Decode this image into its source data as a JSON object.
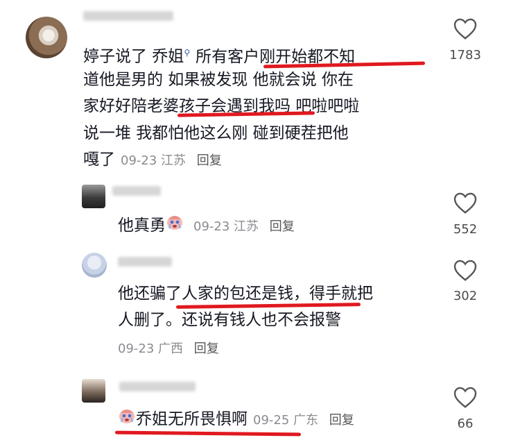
{
  "comments": [
    {
      "lines": [
        "婷子说了  乔姐",
        "所有客户刚开始都不知",
        "道他是男的 如果被发现 他就会说  你在",
        "家好好陪老婆孩子会遇到我吗  吧啦吧啦",
        "说一堆  我都怕他这么刚  碰到硬茬把他",
        "嘎了"
      ],
      "date": "09-23",
      "location": "江苏",
      "reply": "回复",
      "likes": "1783"
    },
    {
      "text": "他真勇",
      "date": "09-23",
      "location": "江苏",
      "reply": "回复",
      "likes": "552"
    },
    {
      "lines": [
        "他还骗了人家的包还是钱，得手就把",
        "人删了。还说有钱人也不会报警"
      ],
      "date": "09-23",
      "location": "广西",
      "reply": "回复",
      "likes": "302"
    },
    {
      "text": "乔姐无所畏惧啊",
      "date": "09-25",
      "location": "广东",
      "reply": "回复",
      "likes": "66"
    }
  ],
  "colors": {
    "underline": "#e0191f",
    "meta": "#8a8b91",
    "text": "#161823"
  },
  "icons": {
    "like": "heart-outline-icon",
    "mention": "search-tag-icon",
    "emoji": "crying-face-emoji"
  }
}
